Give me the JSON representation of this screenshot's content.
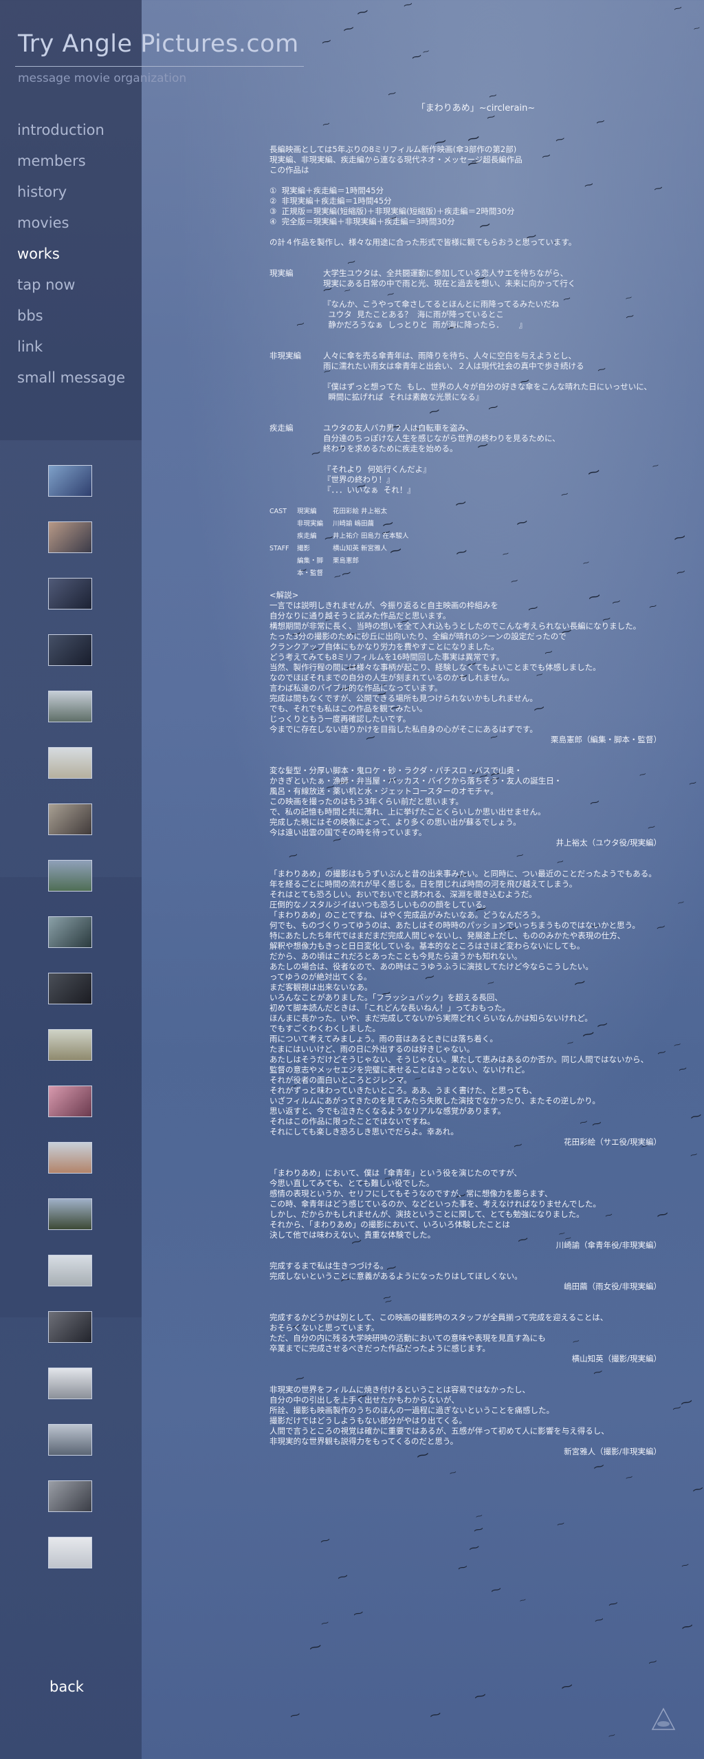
{
  "site": {
    "title": "Try Angle Pictures.com",
    "tagline": "message movie organization"
  },
  "nav": [
    {
      "label": "introduction"
    },
    {
      "label": "members"
    },
    {
      "label": "history"
    },
    {
      "label": "movies"
    },
    {
      "label": "works",
      "active": true
    },
    {
      "label": "tap now"
    },
    {
      "label": "bbs"
    },
    {
      "label": "link"
    },
    {
      "label": "small message"
    }
  ],
  "back_label": "back",
  "thumb_count": 20,
  "content": {
    "title": "「まわりあめ」~circlerain~",
    "intro": "長編映画としては5年ぶりの8ミリフィルム新作映画(傘3部作の第2部)\n現実編、非現実編、疾走編から連なる現代ネオ・メッセージ超長編作品\nこの作品は",
    "list": "①  現実編＋疾走編＝1時間45分\n②  非現実編＋疾走編＝1時間45分\n③  正規版＝現実編(短縮版)＋非現実編(短縮版)＋疾走編＝2時間30分\n④  完全版＝現実編＋非現実編＋疾走編＝3時間30分",
    "outro": "の計４作品を製作し、様々な用途に合った形式で皆様に観てもらおうと思っています。",
    "sections": [
      {
        "label": "現実編",
        "text": "大学生ユウタは、全共闘運動に参加している恋人サエを待ちながら、\n現実にある日常の中で雨と光、現在と過去を想い、未来に向かって行く\n\n『なんか、こうやって傘さしてるとほんとに雨降ってるみたいだね\n  ユウタ  見たことある？  海に雨が降っているとこ\n  静かだろうなぁ  しっとりと  雨が海に降ったら．      』"
      },
      {
        "label": "非現実編",
        "text": "人々に傘を売る傘青年は、雨降りを待ち、人々に空白を与えようとし、\n雨に濡れたい雨女は傘青年と出会い、２人は現代社会の真中で歩き続ける\n\n『僕はずっと想ってた  もし、世界の人々が自分の好きな傘をこんな晴れた日にいっせいに、\n  瞬間に拡げれば  それは素敵な光景になる』"
      },
      {
        "label": "疾走編",
        "text": "ユウタの友人バカ男２人は自転車を盗み、\n自分達のちっぽけな人生を感じながら世界の終わりを見るために、\n終わりを求めるために疾走を始める。\n\n『それより  何処行くんだよ』\n『世界の終わり！』\n『．．．いいなぁ  それ！』"
      }
    ],
    "credits": [
      {
        "c1": "CAST",
        "c2": "現実編",
        "c3": "花田彩絵  井上裕太"
      },
      {
        "c1": "",
        "c2": "非現実編",
        "c3": "川崎諭  嶋田繭"
      },
      {
        "c1": "",
        "c2": "疾走編",
        "c3": "井上祐介  田島力  在本駿人"
      },
      {
        "c1": "STAFF",
        "c2": "撮影",
        "c3": "横山知英  新宮雅人"
      },
      {
        "c1": "",
        "c2": "編集・脚本・監督",
        "c3": "栗島憲郎"
      }
    ],
    "commentary_head": "<解説>",
    "comments": [
      {
        "text": "一言では説明しきれませんが、今振り返ると自主映画の枠組みを\n自分なりに通り越そうと試みた作品だと思います。\n構想期間が非常に長く、当時の想いを全て入れ込もうとしたのでこんな考えられない長編になりました。\nたった3分の撮影のために砂丘に出向いたり、全編が晴れのシーンの設定だったので\nクランクアップ自体にもかなり労力を費やすことになりました。\nどう考えてみても8ミリフィルムを16時間回した事実は異常です。\n当然、製作行程の間には様々な事柄が起こり、経験しなくてもよいことまでも体感しました。\nなのでほぼそれまでの自分の人生が刻まれているのかもしれません。\n言わば私達のバイブル的な作品になっています。\n完成は間もなくですが、公開できる場所も見つけられないかもしれません。\nでも、それでも私はこの作品を観てみたい。\nじっくりともう一度再確認したいです。\n今までに存在しない語りかけを目指した私自身の心がそこにあるはずです。",
        "sig": "栗島憲郎（編集・脚本・監督）"
      },
      {
        "text": "変な髪型・分厚い脚本・鬼ロケ・砂・ラクダ・パチスロ・バスで山奥・\nかきぎといたぁ・漁師・弁当屋・バッカス・バイクから落ちそう・友人の誕生日・\n風呂・有線放送・薬い机と水・ジェットコースターのオモチャ。\nこの映画を撮ったのはもう3年くらい前だと思います。\nで、私の記憶も時間と共に薄れ、上に挙げたことくらいしか思い出せません。\n完成した暁にはその映像によって、より多くの思い出が蘇るでしょう。\n今は遠い出雲の国でその時を待っています。",
        "sig": "井上裕太（ユウタ役/現実編）"
      },
      {
        "text": "「まわりあめ」の撮影はもうずいぶんと昔の出来事みたい。と同時に、つい最近のことだったようでもある。\n年を経るごとに時間の流れが早く感じる。日を閉じれば時間の河を飛び越えてしまう。\nそれはとても恐ろしい。おいでおいでと誘われる、深淵を覗き込むようだ。\n圧倒的なノスタルジイはいつも恐ろしいものの顔をしている。\n「まわりあめ」のことですね、はやく完成品がみたいなあ。どうなんだろう。\n何でも、ものづくりってゆうのは、あたしはその時時のパッションでいっちまうものではないかと思う。\n特にあたしたち年代ではまだまだ完成人間じゃないし、発展途上だし、もののみかたや表現の仕方、\n解釈や想像力もきっと日日変化している。基本的なところはさほど変わらないにしても。\nだから、あの頃はこれだろとあったことも今見たら違うかも知れない。\nあたしの場合は、役者なので、あの時はこうゆうふうに演技してたけど今ならこうしたい。\nってゆうのが絶対出てくる。\nまだ客観視は出来ないなあ。\nいろんなことがありました。「フラッシュバック」を超える長回、\n初めて脚本読んだときは、「これどんな長いねん！」っておもった。\nほんまに長かった。いや、まだ完成してないから実際どれくらいなんかは知らないけれど。\nでもすごくわくわくしました。\n雨について考えてみましょう。雨の音はあるときには落ち着く。\nたまにはいいけど、雨の日に外出するのは好きじゃない。\nあたしはそうだけどそうじゃない、そうじゃない。果たして恵みはあるのか否か。同じ人間ではないから、\n監督の意志やメッセエジを完璧に表せることはきっとない、ないけれど。\nそれが役者の面白いところとジレンマ。\nそれがずっと味わっていきたいところ。ああ、うまく書けた、と思っても、\nいざフィルムにあがってきたのを見てみたら失敗した演技でなかったり、またその逆しかり。\n思い返すと、今でも泣きたくなるようなリアルな感覚があります。\nそれはこの作品に限ったことではないですね。\nそれにしても楽しき恐ろしき思いでだらよ。幸あれ。",
        "sig": "花田彩絵（サエ役/現実編）"
      },
      {
        "text": "「まわりあめ」において、僕は「傘青年」という役を演じたのですが、\n今思い直してみても、とても難しい役でした。\n感情の表現というか、セリフにしてもそうなのですが、常に想像力を膨らます、\nこの時、傘青年はどう感じているのか、などといった事を、考えなければなりませんでした。\nしかし、だからかもしれませんが、演技ということに関して、とても勉強になりました。\nそれから、「まわりあめ」の撮影において、いろいろ体験したことは\n決して他では味わえない、貴重な体験でした。",
        "sig": "川崎諭（傘青年役/非現実編）"
      },
      {
        "text": "完成するまで私は生きつづける。\n完成しないということに意義があるようになったりはしてほしくない。",
        "sig": "嶋田繭（雨女役/非現実編）"
      },
      {
        "text": "完成するかどうかは別として、この映画の撮影時のスタッフが全員揃って完成を迎えることは、\nおそらくないと思っています。\nただ、自分の内に残る大学映研時の活動においての意味や表現を見直す為にも\n卒業までに完成させるべきだった作品だったように感じます。",
        "sig": "横山知英（撮影/現実編）"
      },
      {
        "text": "非現実の世界をフィルムに焼き付けるということは容易ではなかったし、\n自分の中の引出しを上手く出せたかもわからないが、\n所詮、撮影も映画製作のうちのほんの一過程に過ぎないということを痛感した。\n撮影だけではどうしようもない部分がやはり出てくる。\n人間で言うところの視覚は確かに重要ではあるが、五感が伴って初めて人に影響を与え得るし、\n非現実的な世界観も説得力をもってくるのだと思う。",
        "sig": "新宮雅人（撮影/非現実編）"
      }
    ]
  }
}
